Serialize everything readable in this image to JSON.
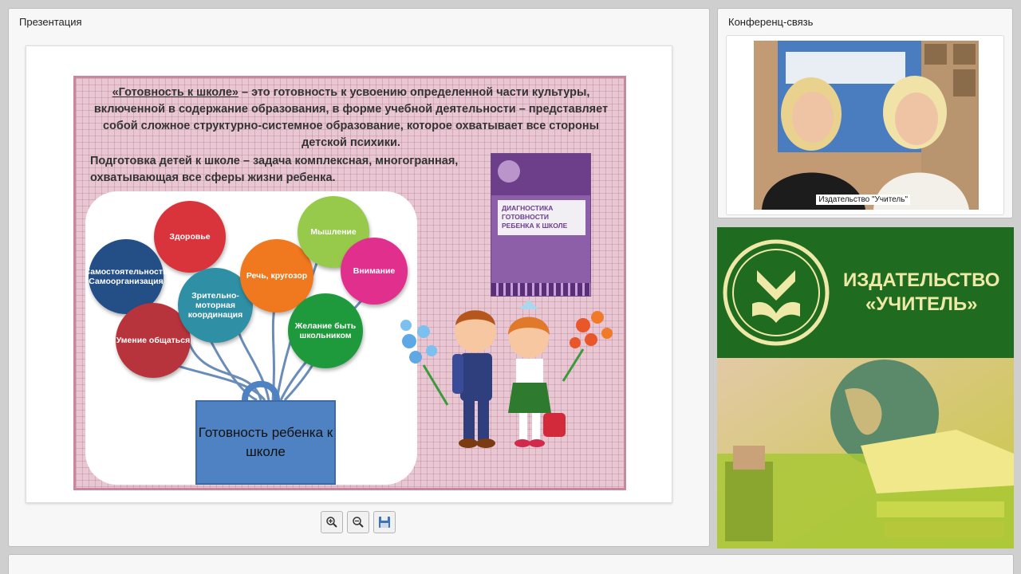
{
  "presentation_panel": {
    "title": "Презентация"
  },
  "slide": {
    "def_term": "«Готовность к школе»",
    "def_rest": " – это готовность к усвоению определенной части культуры, включенной в содержание образования, в форме учебной деятельности – представляет собой сложное структурно-системное образование, которое охватывает все стороны детской психики.",
    "preparation": "Подготовка детей к школе – задача комплексная, многогранная, охватывающая все сферы жизни ребенка.",
    "bubbles": {
      "health": "Здоровье",
      "independence": "Самостоятельность Самоорганизация",
      "communication": "Умение общаться",
      "visual_motor": "Зрительно-моторная координация",
      "speech": "Речь, кругозор",
      "thinking": "Мышление",
      "attention": "Внимание",
      "desire": "Желание быть школьником"
    },
    "readiness_box": "Готовность ребенка к школе",
    "book_title": "ДИАГНОСТИКА ГОТОВНОСТИ РЕБЕНКА К ШКОЛЕ"
  },
  "toolbar": {
    "zoom_in": "zoom-in",
    "zoom_out": "zoom-out",
    "save": "save"
  },
  "conference_panel": {
    "title": "Конференц-связь",
    "caption": "Издательство \"Учитель\""
  },
  "promo": {
    "publisher_line1": "ИЗДАТЕЛЬСТВО",
    "publisher_line2": "«УЧИТЕЛЬ»"
  },
  "colors": {
    "slide_bg": "#e8c7d3",
    "promo_green": "#1f6b1f",
    "promo_text": "#efe9a7",
    "bubble_health": "#d9343b",
    "bubble_independence": "#234f86",
    "bubble_communication": "#b8343c",
    "bubble_visual_motor": "#2f8fa4",
    "bubble_speech": "#f0781e",
    "bubble_thinking": "#97c94a",
    "bubble_attention": "#e12f8e",
    "bubble_desire": "#1e9a3c",
    "readiness_box": "#4f82c2"
  }
}
